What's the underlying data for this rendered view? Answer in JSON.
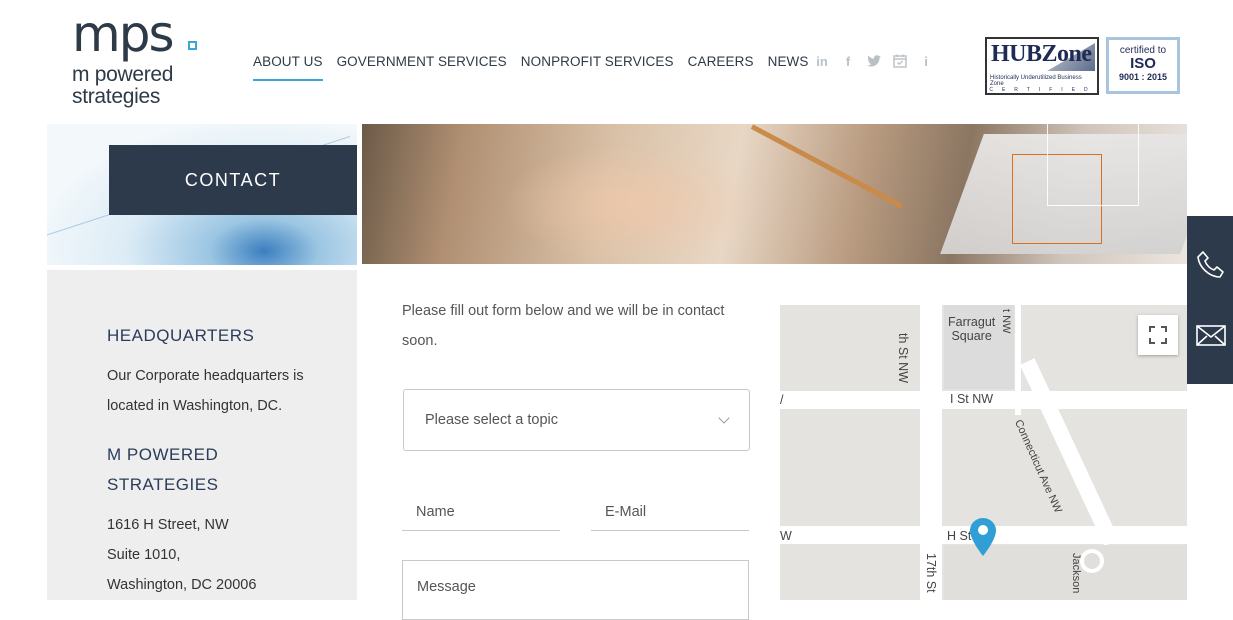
{
  "logo": {
    "mark": "mps",
    "line1": "m powered",
    "line2": "strategies"
  },
  "nav": [
    {
      "label": "ABOUT US",
      "active": true
    },
    {
      "label": "GOVERNMENT SERVICES"
    },
    {
      "label": "NONPROFIT SERVICES"
    },
    {
      "label": "CAREERS"
    },
    {
      "label": "NEWS"
    }
  ],
  "social": [
    "linkedin-icon",
    "facebook-icon",
    "twitter-icon",
    "calendar-icon",
    "info-icon"
  ],
  "badges": {
    "hubzone": {
      "title": "HUBZone",
      "subtitle": "Historically Underutilized Business Zone",
      "cert": "CERTIFIED"
    },
    "iso": {
      "line1": "certified to",
      "line2": "ISO",
      "line3": "9001 : 2015"
    }
  },
  "hero": {
    "title": "CONTACT"
  },
  "sidebar": {
    "headquarters_title": "HEADQUARTERS",
    "headquarters_text": "Our Corporate headquarters is located in Washington, DC.",
    "company_title": "M POWERED STRATEGIES",
    "address": [
      "1616 H Street, NW",
      "Suite 1010,",
      "Washington, DC 20006"
    ]
  },
  "form": {
    "intro": "Please fill out form below and we will be in contact soon.",
    "topic_placeholder": "Please select a topic",
    "name_placeholder": "Name",
    "email_placeholder": "E-Mail",
    "message_placeholder": "Message"
  },
  "map": {
    "labels": {
      "farragut": "Farragut\nSquare",
      "th_st": "th St NW",
      "i_st": "I St NW",
      "conn": "Connecticut Ave NW",
      "h_st": "H St NW",
      "seventeenth": "17th St",
      "jackson": "Jackson",
      "w_left": "W",
      "slash_left": "/",
      "t_nw": "t NW"
    }
  },
  "colors": {
    "navy": "#2c3a4b",
    "accent": "#3aa6d8",
    "sidebar_bg": "#eeeeee"
  }
}
